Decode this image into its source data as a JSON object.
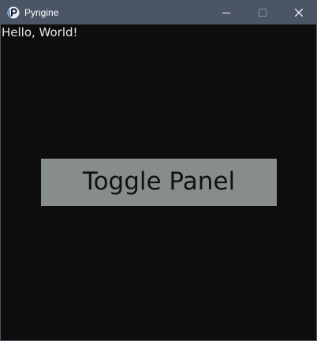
{
  "window": {
    "title": "Pyngine",
    "app_icon": "pyngine-p-icon",
    "titlebar_color": "#4b5566",
    "controls": [
      "minimize-icon",
      "maximize-icon",
      "close-icon"
    ]
  },
  "content": {
    "background_color": "#0d0d0d",
    "greeting": "Hello, World!",
    "toggle_button": {
      "label": "Toggle Panel",
      "color": "#878e89"
    }
  }
}
